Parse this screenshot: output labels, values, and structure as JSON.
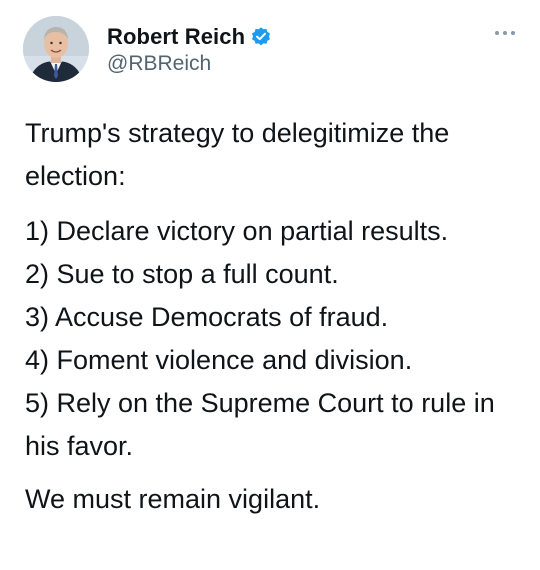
{
  "tweet": {
    "author": {
      "display_name": "Robert Reich",
      "handle": "@RBReich",
      "verified": true
    },
    "text": {
      "intro_line1": "Trump's strategy to delegitimize the",
      "intro_line2": "election:",
      "items": [
        "1) Declare victory on partial results.",
        "2) Sue to stop a full count.",
        "3) Accuse Democrats of fraud.",
        "4) Foment violence and division.",
        "5) Rely on the Supreme Court to rule in",
        "his favor."
      ],
      "closing": "We must remain vigilant."
    }
  },
  "icons": {
    "verified": "verified-badge-icon",
    "more": "more-options-icon",
    "avatar": "profile-avatar"
  },
  "colors": {
    "text": "#0f1419",
    "secondary": "#536471",
    "verified": "#1d9bf0"
  }
}
